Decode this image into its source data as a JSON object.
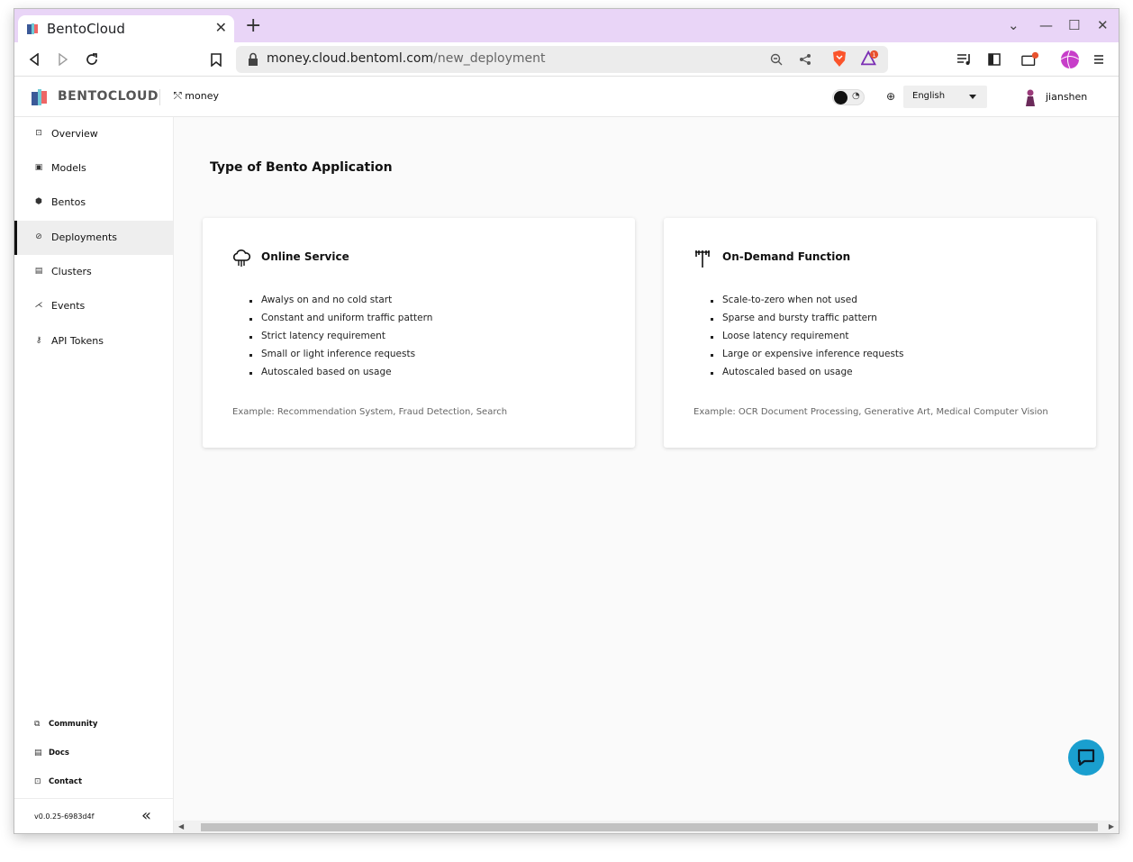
{
  "browser": {
    "tab_title": "BentoCloud",
    "tab_close": "✕",
    "new_tab": "+",
    "url_host": "money.cloud.bentoml.com",
    "url_path": "/new_deployment",
    "window_controls": {
      "dropdown": "⌄",
      "minimize": "—",
      "maximize": "☐",
      "close": "✕"
    },
    "notification_count": "1"
  },
  "header": {
    "logo_text": "BENTOCLOUD",
    "org_name": "money",
    "language": "English",
    "username": "jianshen"
  },
  "sidebar": {
    "items": [
      {
        "label": "Overview",
        "icon": "overview-icon"
      },
      {
        "label": "Models",
        "icon": "models-icon"
      },
      {
        "label": "Bentos",
        "icon": "bentos-icon"
      },
      {
        "label": "Deployments",
        "icon": "deployments-icon",
        "active": true
      },
      {
        "label": "Clusters",
        "icon": "clusters-icon"
      },
      {
        "label": "Events",
        "icon": "events-icon"
      },
      {
        "label": "API Tokens",
        "icon": "api-tokens-icon"
      }
    ],
    "footer": [
      {
        "label": "Community",
        "icon": "community-icon"
      },
      {
        "label": "Docs",
        "icon": "docs-icon"
      },
      {
        "label": "Contact",
        "icon": "contact-icon"
      }
    ],
    "version": "v0.0.25-6983d4f",
    "collapse": "«"
  },
  "main": {
    "title": "Type of Bento Application",
    "cards": [
      {
        "title": "Online Service",
        "icon": "cloud-icon",
        "bullets": [
          "Awalys on and no cold start",
          "Constant and uniform traffic pattern",
          "Strict latency requirement",
          "Small or light inference requests",
          "Autoscaled based on usage"
        ],
        "example": "Example: Recommendation System, Fraud Detection, Search"
      },
      {
        "title": "On-Demand Function",
        "icon": "function-icon",
        "bullets": [
          "Scale-to-zero when not used",
          "Sparse and bursty traffic pattern",
          "Loose latency requirement",
          "Large or expensive inference requests",
          "Autoscaled based on usage"
        ],
        "example": "Example: OCR Document Processing, Generative Art, Medical Computer Vision"
      }
    ]
  },
  "colors": {
    "tabstrip": "#e9d5f7",
    "chat_button": "#1a9fcf",
    "active_nav": "#eeeeee"
  }
}
